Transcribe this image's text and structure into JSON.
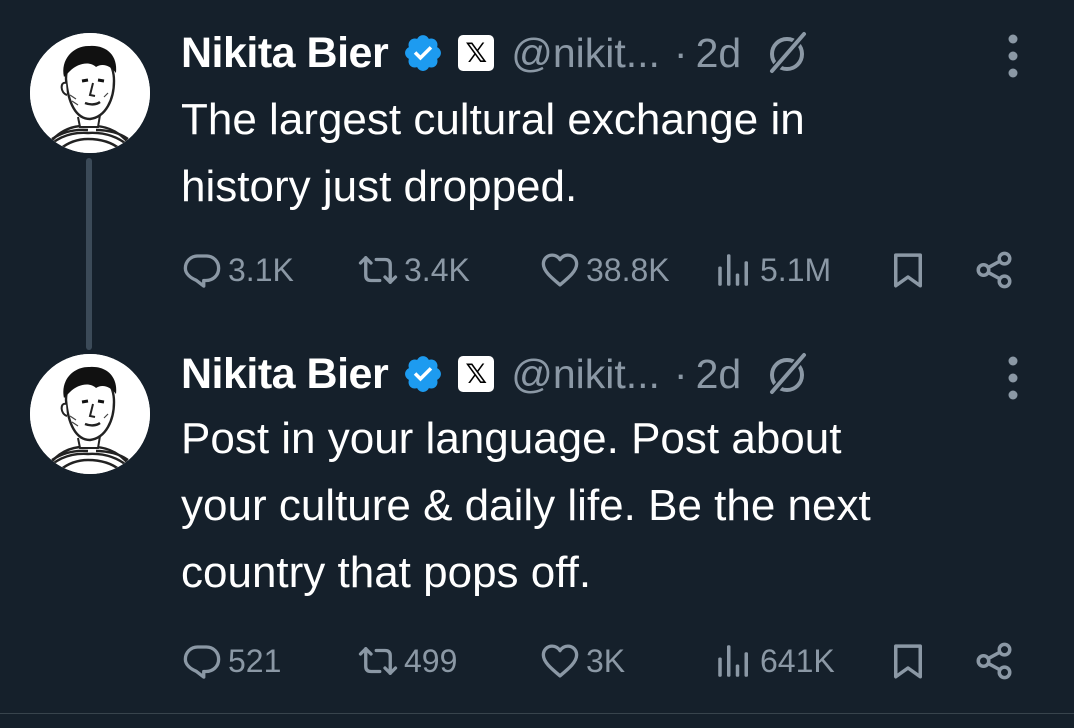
{
  "tweets": [
    {
      "author": {
        "display_name": "Nikita Bier",
        "handle": "@nikit...",
        "verified": true,
        "affiliation_badge": "𝕏"
      },
      "separator": "·",
      "time": "2d",
      "text": "The largest cultural exchange in\nhistory just dropped.",
      "actions": {
        "replies": "3.1K",
        "reposts": "3.4K",
        "likes": "38.8K",
        "views": "5.1M"
      }
    },
    {
      "author": {
        "display_name": "Nikita Bier",
        "handle": "@nikit...",
        "verified": true,
        "affiliation_badge": "𝕏"
      },
      "separator": "·",
      "time": "2d",
      "text": "Post in your language. Post about\nyour culture & daily life. Be the next\ncountry that pops off.",
      "actions": {
        "replies": "521",
        "reposts": "499",
        "likes": "3K",
        "views": "641K"
      }
    }
  ],
  "icons": {
    "reply": "reply-icon",
    "repost": "repost-icon",
    "like": "heart-icon",
    "views": "views-icon",
    "bookmark": "bookmark-icon",
    "share": "share-icon",
    "grok": "grok-icon",
    "more": "more-icon",
    "verified": "verified-badge-icon"
  },
  "colors": {
    "background": "#15202b",
    "text": "#ffffff",
    "secondary": "#8b98a5",
    "verified": "#1d9bf0",
    "thread_line": "#3b4a58"
  }
}
